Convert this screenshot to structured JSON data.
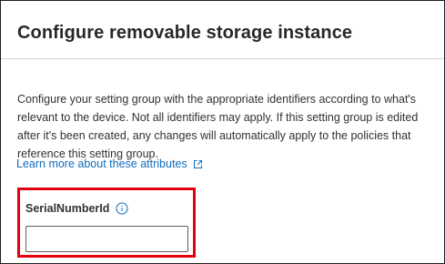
{
  "dialog": {
    "title": "Configure removable storage instance",
    "description": "Configure your setting group with the appropriate identifiers according to what's relevant to the device. Not all identifiers may apply. If this setting group is edited after it's been created, any changes will automatically apply to the policies that reference this setting group.",
    "learn_more_link": "Learn more about these attributes"
  },
  "field": {
    "label": "SerialNumberId",
    "value": "",
    "placeholder": "",
    "info_icon": "info-icon"
  },
  "colors": {
    "link": "#0f6cbd",
    "highlight_border": "#e3000f",
    "text": "#323130"
  },
  "icons": {
    "learn_more": "external-link-icon",
    "field_info": "info-icon"
  }
}
